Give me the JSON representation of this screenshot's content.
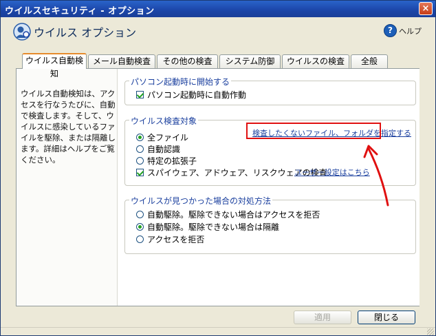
{
  "window": {
    "title": "ウイルスセキュリティ - オプション",
    "close_glyph": "×"
  },
  "header": {
    "title": "ウイルス オプション",
    "help_label": "ヘルプ",
    "help_glyph": "?"
  },
  "tabs": [
    {
      "label": "ウイルス自動検知",
      "active": true
    },
    {
      "label": "メール自動検査",
      "active": false
    },
    {
      "label": "その他の検査",
      "active": false
    },
    {
      "label": "システム防御",
      "active": false
    },
    {
      "label": "ウイルスの検査",
      "active": false
    },
    {
      "label": "全般",
      "active": false
    }
  ],
  "description": "ウイルス自動検知は、アクセスを行なうたびに、自動で検査します。そして、ウイルスに感染しているファイルを駆除、または隔離します。詳細はヘルプをご覧ください。",
  "startup": {
    "label": "パソコン起動時に開始する",
    "checkbox_label": "パソコン起動時に自動作動",
    "checked": true
  },
  "scan_target": {
    "label": "ウイルス検査対象",
    "options": [
      {
        "label": "全ファイル",
        "selected": true
      },
      {
        "label": "自動認識",
        "selected": false
      },
      {
        "label": "特定の拡張子",
        "selected": false
      }
    ],
    "spyware_label": "スパイウェア、アドウェア、リスクウェアの検査",
    "spyware_checked": true,
    "exclude_link": "検査したくないファイル、フォルダを指定する",
    "user_settings_link": "ユーザー設定はこちら"
  },
  "action": {
    "label": "ウイルスが見つかった場合の対処方法",
    "options": [
      {
        "label": "自動駆除。駆除できない場合はアクセスを拒否",
        "selected": false
      },
      {
        "label": "自動駆除。駆除できない場合は隔離",
        "selected": true
      },
      {
        "label": "アクセスを拒否",
        "selected": false
      }
    ]
  },
  "buttons": {
    "apply": "適用",
    "close": "閉じる"
  },
  "colors": {
    "highlight": "#e01010",
    "titlebar": "#1b45a8",
    "accent_tab": "#e68b2c"
  }
}
